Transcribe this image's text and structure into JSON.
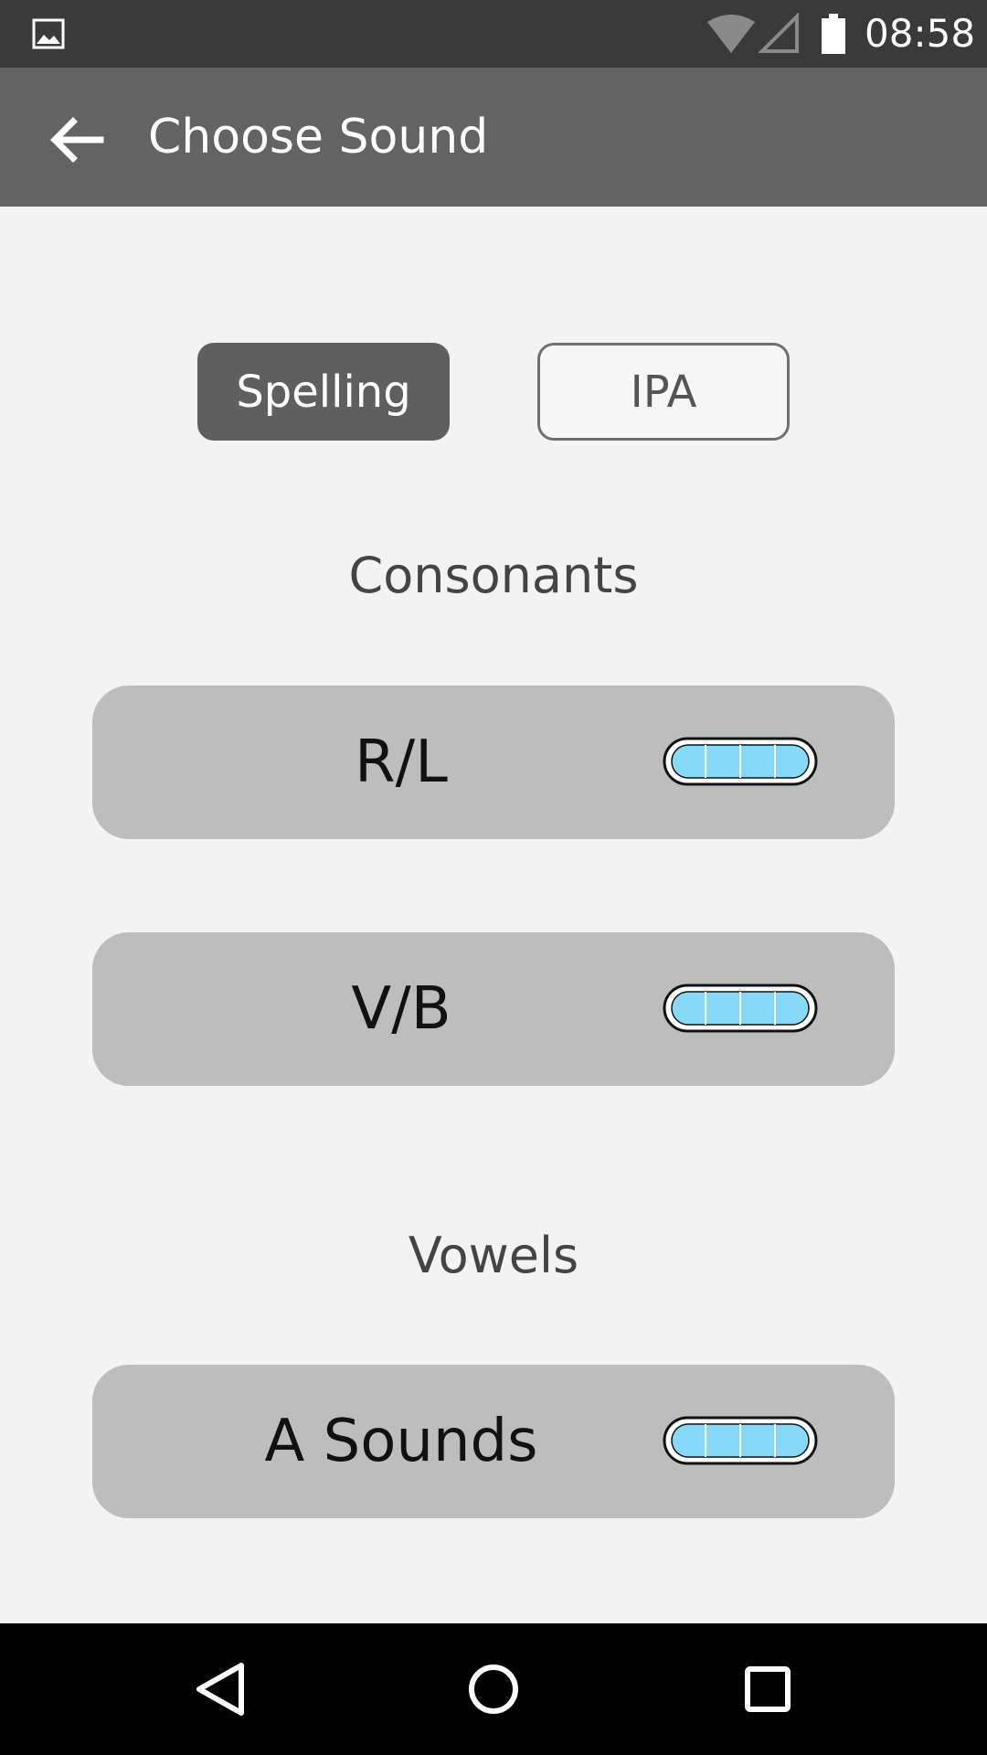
{
  "status_bar": {
    "time": "08:58",
    "icons": [
      "gallery-icon",
      "wifi-icon",
      "signal-icon",
      "battery-icon"
    ]
  },
  "app_bar": {
    "title": "Choose Sound",
    "back_icon": "arrow-back-icon"
  },
  "mode_toggle": {
    "options": [
      {
        "label": "Spelling",
        "selected": true
      },
      {
        "label": "IPA",
        "selected": false
      }
    ]
  },
  "sections": [
    {
      "heading": "Consonants",
      "items": [
        {
          "label": "R/L",
          "progress_segments_filled": 4,
          "progress_segments_total": 4
        },
        {
          "label": "V/B",
          "progress_segments_filled": 4,
          "progress_segments_total": 4
        }
      ]
    },
    {
      "heading": "Vowels",
      "items": [
        {
          "label": "A Sounds",
          "progress_segments_filled": 4,
          "progress_segments_total": 4
        }
      ]
    }
  ],
  "nav_bar": {
    "buttons": [
      "nav-back-icon",
      "nav-home-icon",
      "nav-recents-icon"
    ]
  },
  "colors": {
    "status_bar": "#3a3a3a",
    "app_bar": "#636363",
    "background": "#f3f3f3",
    "card": "#bdbdbd",
    "selected_toggle": "#5f5f5f",
    "progress_fill": "#87d9f8"
  }
}
